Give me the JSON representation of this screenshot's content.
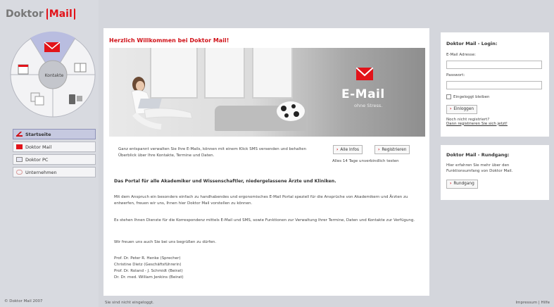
{
  "app": {
    "logo_part1": "Doktor",
    "logo_part2": "Mail"
  },
  "wheel": {
    "center_label": "Kontakte"
  },
  "nav": {
    "items": [
      {
        "label": "Startseite",
        "icon": "home-icon"
      },
      {
        "label": "Doktor Mail",
        "icon": "envelope-icon"
      },
      {
        "label": "Doktor PC",
        "icon": "pc-icon"
      },
      {
        "label": "Unternehmen",
        "icon": "company-icon"
      }
    ]
  },
  "sidebar_footer": "© Doktor Mail 2007",
  "main": {
    "welcome_title": "Herzlich Willkommen bei Doktor Mail!",
    "hero": {
      "brand": "E-Mail",
      "tagline": "ohne Stress."
    },
    "intro_text": "Ganz entspannt verwalten Sie Ihre E-Mails, können mit einem Klick SMS versenden und behalten Überblick über Ihre Kontakte, Termine und Daten.",
    "btn_infos": "Alle Infos",
    "btn_register": "Registrieren",
    "intro_note": "Alles 14 Tage unverbindlich testen",
    "portal_heading": "Das Portal für alle Akademiker und Wissenschaftler, niedergelassene Ärzte und Kliniken.",
    "para1": "Mit dem Anspruch ein besonders einfach zu handhabendes und ergonomisches E-Mail Portal speziell für die Ansprüche von Akademikern und Ärzten zu entwerfen, freuen wir uns, Ihnen hier Doktor Mail vorstellen zu können.",
    "para2": "Es stehen Ihnen Dienste für die Korrespondenz mittels E-Mail und SMS, sowie Funktionen zur Verwaltung Ihrer Termine, Daten und Kontakte zur Verfügung.",
    "para3": "Wir freuen uns auch Sie bei uns begrüßen zu dürfen.",
    "signatures": [
      "Prof. Dr. Peter R. Henke (Sprecher)",
      "Christine Dietz (Geschäftsführerin)",
      "Prof. Dr. Roland - J. Schmidt (Beirat)",
      "Dr. Dr. med. William Jenkins (Beirat)"
    ]
  },
  "login": {
    "title": "Doktor Mail - Login:",
    "email_label": "E-Mail Adresse:",
    "password_label": "Passwort:",
    "remember_label": "Eingeloggt bleiben",
    "login_button": "Einloggen",
    "not_registered": "Noch nicht registriert?",
    "register_link": "Dann registrieren Sie sich jetzt!"
  },
  "tour": {
    "title": "Doktor Mail - Rundgang:",
    "text": "Hier erfahren Sie mehr über den Funktionsumfang von Doktor Mail.",
    "button": "Rundgang"
  },
  "status": {
    "left": "Sie sind nicht eingeloggt.",
    "right": "Impressum | Hilfe"
  },
  "colors": {
    "brand_red": "#e2131a",
    "nav_active": "#c6c9e0"
  }
}
